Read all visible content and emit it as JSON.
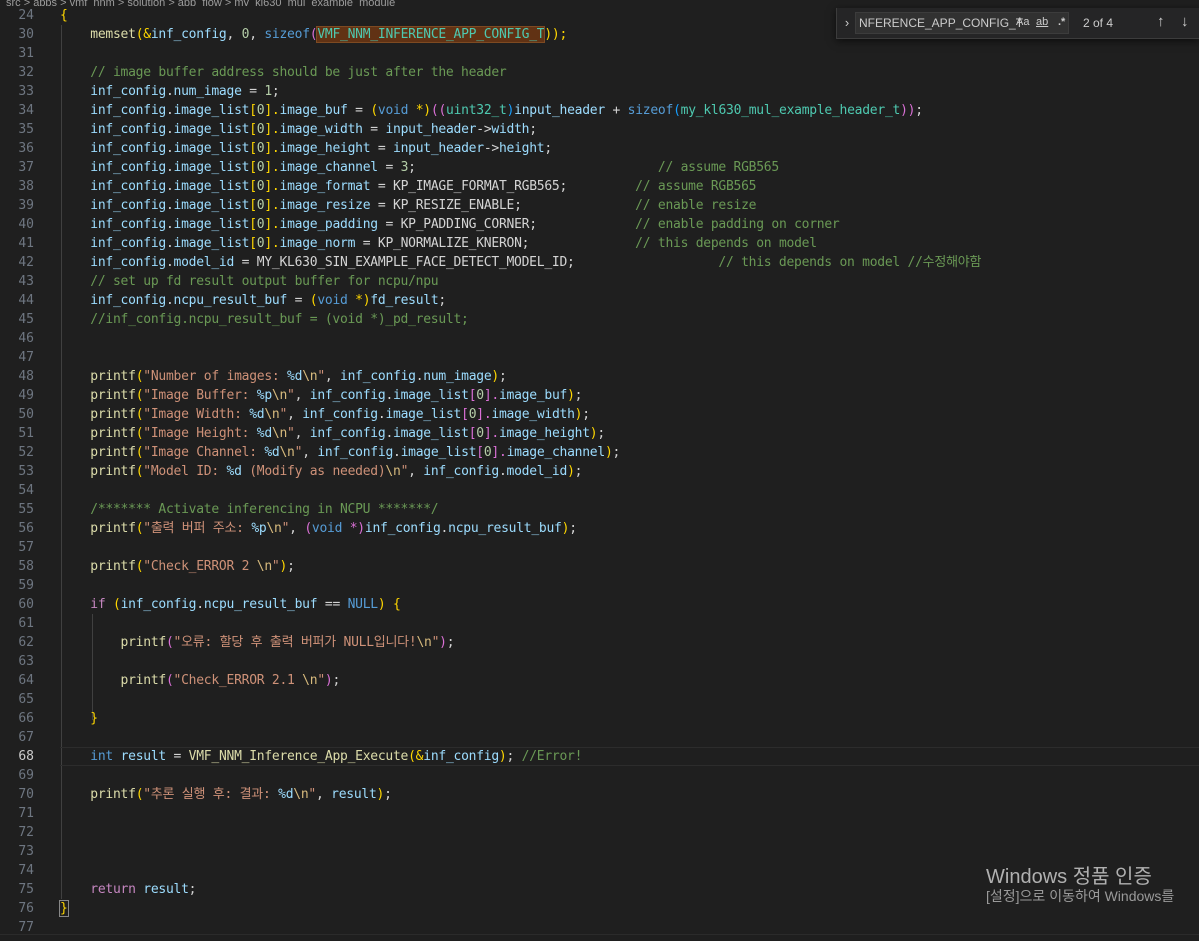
{
  "breadcrumb": "src > apps > vmf_nnm > solution > app_flow > my_kl630_mul_example_module",
  "find_widget": {
    "search_value": "NFERENCE_APP_CONFIG_T",
    "match_case_label": "Aa",
    "whole_word_label": "ab",
    "regex_label": ".*",
    "match_count": "2 of 4",
    "toggle_icon": "chevron-right-icon",
    "prev_icon": "arrow-up-icon",
    "next_icon": "arrow-down-icon"
  },
  "editor": {
    "line_numbers": [
      "24",
      "30",
      "31",
      "32",
      "33",
      "34",
      "35",
      "36",
      "37",
      "38",
      "39",
      "40",
      "41",
      "42",
      "43",
      "44",
      "45",
      "46",
      "47",
      "48",
      "49",
      "50",
      "51",
      "52",
      "53",
      "54",
      "55",
      "56",
      "57",
      "58",
      "59",
      "60",
      "61",
      "62",
      "63",
      "64",
      "65",
      "66",
      "67",
      "68",
      "69",
      "70",
      "71",
      "72",
      "73",
      "74",
      "75",
      "76",
      "77"
    ],
    "current_line": "68",
    "lines": {
      "l24_brace": "{",
      "l30_a": "memset",
      "l30_b": "(&",
      "l30_c": "inf_config",
      "l30_d": ", ",
      "l30_e": "0",
      "l30_f": ", ",
      "l30_g": "sizeof",
      "l30_h": "(",
      "l30_i": "VMF_NNM_INFERENCE_APP_CONFIG_T",
      "l30_j": "));",
      "l32": "// image buffer address should be just after the header",
      "l33_a": "inf_config",
      "l33_b": ".",
      "l33_c": "num_image",
      "l33_d": " = ",
      "l33_e": "1",
      "l33_f": ";",
      "l34_a": "inf_config",
      "l34_b": ".",
      "l34_c": "image_list",
      "l34_d": "[",
      "l34_e": "0",
      "l34_f": "].",
      "l34_g": "image_buf",
      "l34_h": " = ",
      "l34_i": "(",
      "l34_j": "void",
      "l34_k": " *)",
      "l34_l": "((",
      "l34_m": "uint32_t",
      "l34_n": ")",
      "l34_o": "input_header",
      "l34_p": " + ",
      "l34_q": "sizeof",
      "l34_r": "(",
      "l34_s": "my_kl630_mul_example_header_t",
      "l34_t": "))",
      "l34_u": ";",
      "l35_a": "inf_config",
      "l35_b": ".",
      "l35_c": "image_list",
      "l35_d": "[",
      "l35_e": "0",
      "l35_f": "].",
      "l35_g": "image_width",
      "l35_h": " = ",
      "l35_i": "input_header",
      "l35_j": "->",
      "l35_k": "width",
      "l35_l": ";",
      "l36_a": "inf_config",
      "l36_b": ".",
      "l36_c": "image_list",
      "l36_d": "[",
      "l36_e": "0",
      "l36_f": "].",
      "l36_g": "image_height",
      "l36_h": " = ",
      "l36_i": "input_header",
      "l36_j": "->",
      "l36_k": "height",
      "l36_l": ";",
      "l37_a": "inf_config",
      "l37_b": ".",
      "l37_c": "image_list",
      "l37_d": "[",
      "l37_e": "0",
      "l37_f": "].",
      "l37_g": "image_channel",
      "l37_h": " = ",
      "l37_i": "3",
      "l37_j": ";",
      "l37_pad": "                                ",
      "l37_cm": "// assume RGB565",
      "l38_a": "inf_config",
      "l38_b": ".",
      "l38_c": "image_list",
      "l38_d": "[",
      "l38_e": "0",
      "l38_f": "].",
      "l38_g": "image_format",
      "l38_h": " = ",
      "l38_i": "KP_IMAGE_FORMAT_RGB565",
      "l38_j": ";",
      "l38_pad": "         ",
      "l38_cm": "// assume RGB565",
      "l39_a": "inf_config",
      "l39_b": ".",
      "l39_c": "image_list",
      "l39_d": "[",
      "l39_e": "0",
      "l39_f": "].",
      "l39_g": "image_resize",
      "l39_h": " = ",
      "l39_i": "KP_RESIZE_ENABLE",
      "l39_j": ";",
      "l39_pad": "               ",
      "l39_cm": "// enable resize",
      "l40_a": "inf_config",
      "l40_b": ".",
      "l40_c": "image_list",
      "l40_d": "[",
      "l40_e": "0",
      "l40_f": "].",
      "l40_g": "image_padding",
      "l40_h": " = ",
      "l40_i": "KP_PADDING_CORNER",
      "l40_j": ";",
      "l40_pad": "             ",
      "l40_cm": "// enable padding on corner",
      "l41_a": "inf_config",
      "l41_b": ".",
      "l41_c": "image_list",
      "l41_d": "[",
      "l41_e": "0",
      "l41_f": "].",
      "l41_g": "image_norm",
      "l41_h": " = ",
      "l41_i": "KP_NORMALIZE_KNERON",
      "l41_j": ";",
      "l41_pad": "              ",
      "l41_cm": "// this depends on model",
      "l42_a": "inf_config",
      "l42_b": ".",
      "l42_c": "model_id",
      "l42_d": " = ",
      "l42_e": "MY_KL630_SIN_EXAMPLE_FACE_DETECT_MODEL_ID",
      "l42_f": ";",
      "l42_pad": "                   ",
      "l42_cm": "// this depends on model //수정해야함",
      "l43": "// set up fd result output buffer for ncpu/npu",
      "l44_a": "inf_config",
      "l44_b": ".",
      "l44_c": "ncpu_result_buf",
      "l44_d": " = ",
      "l44_e": "(",
      "l44_f": "void",
      "l44_g": " *)",
      "l44_h": "fd_result",
      "l44_i": ";",
      "l45": "//inf_config.ncpu_result_buf = (void *)_pd_result;",
      "l48_a": "printf",
      "l48_b": "(",
      "l48_c": "\"Number of images: ",
      "l48_d": "%d",
      "l48_e": "\\n",
      "l48_f": "\"",
      "l48_g": ", ",
      "l48_h": "inf_config",
      "l48_i": ".",
      "l48_j": "num_image",
      "l48_k": ")",
      "l48_l": ";",
      "l49_a": "printf",
      "l49_b": "(",
      "l49_c": "\"Image Buffer: ",
      "l49_d": "%p",
      "l49_e": "\\n",
      "l49_f": "\"",
      "l49_g": ", ",
      "l49_h": "inf_config",
      "l49_i": ".",
      "l49_j": "image_list",
      "l49_k": "[",
      "l49_l": "0",
      "l49_m": "].",
      "l49_n": "image_buf",
      "l49_o": ")",
      "l49_p": ";",
      "l50_a": "printf",
      "l50_b": "(",
      "l50_c": "\"Image Width: ",
      "l50_d": "%d",
      "l50_e": "\\n",
      "l50_f": "\"",
      "l50_g": ", ",
      "l50_h": "inf_config",
      "l50_i": ".",
      "l50_j": "image_list",
      "l50_k": "[",
      "l50_l": "0",
      "l50_m": "].",
      "l50_n": "image_width",
      "l50_o": ")",
      "l50_p": ";",
      "l51_a": "printf",
      "l51_b": "(",
      "l51_c": "\"Image Height: ",
      "l51_d": "%d",
      "l51_e": "\\n",
      "l51_f": "\"",
      "l51_g": ", ",
      "l51_h": "inf_config",
      "l51_i": ".",
      "l51_j": "image_list",
      "l51_k": "[",
      "l51_l": "0",
      "l51_m": "].",
      "l51_n": "image_height",
      "l51_o": ")",
      "l51_p": ";",
      "l52_a": "printf",
      "l52_b": "(",
      "l52_c": "\"Image Channel: ",
      "l52_d": "%d",
      "l52_e": "\\n",
      "l52_f": "\"",
      "l52_g": ", ",
      "l52_h": "inf_config",
      "l52_i": ".",
      "l52_j": "image_list",
      "l52_k": "[",
      "l52_l": "0",
      "l52_m": "].",
      "l52_n": "image_channel",
      "l52_o": ")",
      "l52_p": ";",
      "l53_a": "printf",
      "l53_b": "(",
      "l53_c": "\"Model ID: ",
      "l53_d": "%d",
      "l53_e": " (Modify as needed)",
      "l53_f": "\\n",
      "l53_g": "\"",
      "l53_h": ", ",
      "l53_i": "inf_config",
      "l53_j": ".",
      "l53_k": "model_id",
      "l53_l": ")",
      "l53_m": ";",
      "l55": "/******* Activate inferencing in NCPU *******/",
      "l56_a": "printf",
      "l56_b": "(",
      "l56_c": "\"출력 버퍼 주소: ",
      "l56_d": "%p",
      "l56_e": "\\n",
      "l56_f": "\"",
      "l56_g": ", ",
      "l56_h": "(",
      "l56_i": "void",
      "l56_j": " *)",
      "l56_k": "inf_config",
      "l56_l": ".",
      "l56_m": "ncpu_result_buf",
      "l56_n": ")",
      "l56_o": ";",
      "l58_a": "printf",
      "l58_b": "(",
      "l58_c": "\"Check_ERROR 2 ",
      "l58_d": "\\n",
      "l58_e": "\"",
      "l58_f": ")",
      "l58_g": ";",
      "l60_a": "if",
      "l60_b": " (",
      "l60_c": "inf_config",
      "l60_d": ".",
      "l60_e": "ncpu_result_buf",
      "l60_f": " == ",
      "l60_g": "NULL",
      "l60_h": ") ",
      "l60_i": "{",
      "l62_a": "printf",
      "l62_b": "(",
      "l62_c": "\"오류: 할당 후 출력 버퍼가 NULL입니다!",
      "l62_d": "\\n",
      "l62_e": "\"",
      "l62_f": ")",
      "l62_g": ";",
      "l64_a": "printf",
      "l64_b": "(",
      "l64_c": "\"Check_ERROR 2.1 ",
      "l64_d": "\\n",
      "l64_e": "\"",
      "l64_f": ")",
      "l64_g": ";",
      "l66": "}",
      "l68_a": "int",
      "l68_b": " ",
      "l68_c": "result",
      "l68_d": " = ",
      "l68_e": "VMF_NNM_Inference_App_Execute",
      "l68_f": "(&",
      "l68_g": "inf_config",
      "l68_h": ")",
      "l68_i": "; ",
      "l68_j": "//Error!",
      "l70_a": "printf",
      "l70_b": "(",
      "l70_c": "\"추론 실행 후: 결과: ",
      "l70_d": "%d",
      "l70_e": "\\n",
      "l70_f": "\"",
      "l70_g": ", ",
      "l70_h": "result",
      "l70_i": ")",
      "l70_j": ";",
      "l75_a": "return",
      "l75_b": " ",
      "l75_c": "result",
      "l75_d": ";",
      "l76": "}"
    }
  },
  "watermark": {
    "title": "Windows 정품 인증",
    "subtitle": "[설정]으로 이동하여 Windows를"
  },
  "colors": {
    "background": "#1f1f1f",
    "find_highlight": "#613214",
    "function": "#dcdcaa",
    "variable": "#9cdcfe",
    "type": "#4ec9b0",
    "keyword": "#569cd6",
    "string": "#ce9178",
    "comment": "#6a9955",
    "number": "#b5cea8"
  }
}
